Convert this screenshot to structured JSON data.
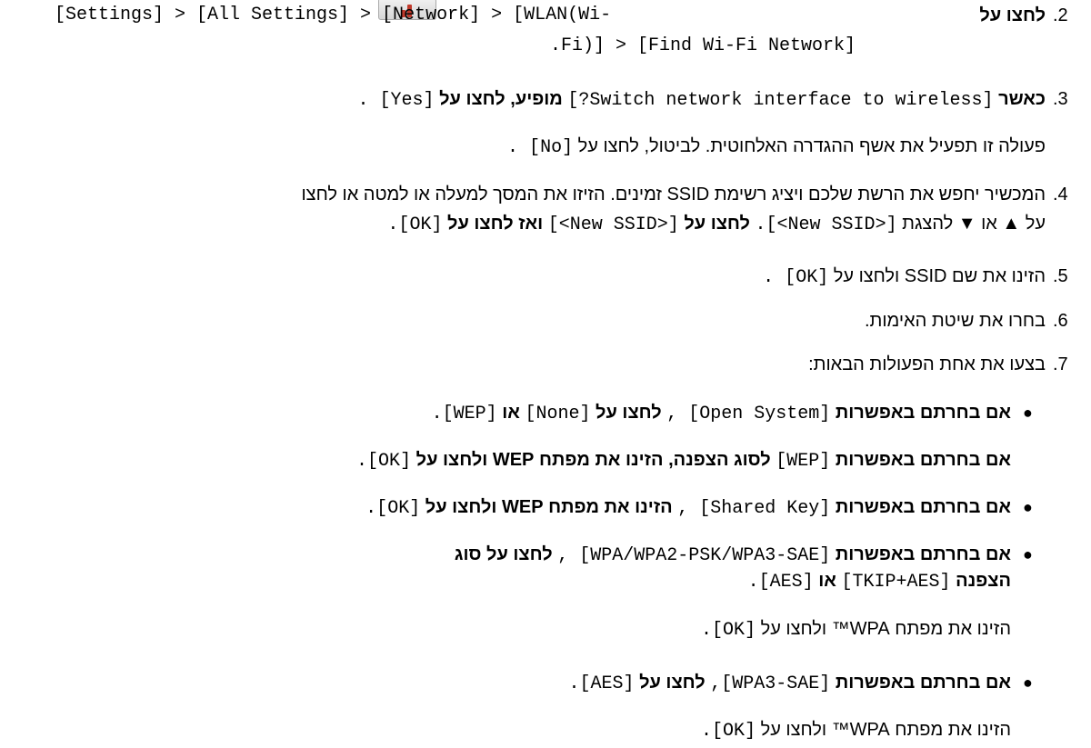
{
  "steps": {
    "s2": {
      "num": ".2",
      "verb": "לחצו על",
      "path1": "[Settings] > [All Settings] > [Network] > [WLAN(Wi-",
      "path2": ".Fi)] > [Find Wi-Fi Network]"
    },
    "s3": {
      "num": ".3",
      "when": "כאשר",
      "prompt": "[Switch network interface to wireless?]",
      "appears": "מופיע, לחצו על",
      "yes": "[Yes] .",
      "note": "פעולה זו תפעיל את אשף ההגדרה האלחוטית. לביטול, לחצו על",
      "no": "[No] ."
    },
    "s4": {
      "num": ".4",
      "line1": "המכשיר יחפש את הרשת שלכם ויציג רשימת SSID זמינים. הזיזו את המסך למעלה או למטה או לחצו",
      "l2a": "על ▲ או ▼ להצגת",
      "new_ssid1": "[<New SSID>].",
      "click": "לחצו על",
      "new_ssid2": "[<New SSID>]",
      "then_click": "ואז לחצו על",
      "ok": "[OK]."
    },
    "s5": {
      "num": ".5",
      "text": "הזינו את שם SSID ולחצו על",
      "ok": "[OK] ."
    },
    "s6": {
      "num": ".6",
      "text": "בחרו את שיטת האימות."
    },
    "s7": {
      "num": ".7",
      "text": "בצעו את אחת הפעולות הבאות:"
    }
  },
  "bullets": {
    "open": {
      "if": "אם בחרתם באפשרות",
      "opt": "[Open System] ,",
      "click": "לחצו על",
      "none": "[None]",
      "or": "או",
      "wep": "[WEP]."
    },
    "wep_note": {
      "if": "אם בחרתם באפשרות",
      "opt": "[WEP]",
      "text": "לסוג הצפנה, הזינו את מפתח WEP ולחצו על",
      "ok": "[OK]."
    },
    "shared": {
      "if": "אם בחרתם באפשרות",
      "opt": "[Shared Key] ,",
      "text": "הזינו את מפתח WEP ולחצו על",
      "ok": "[OK]."
    },
    "wpa": {
      "if": "אם בחרתם באפשרות",
      "opt": "[WPA/WPA2-PSK/WPA3-SAE] ,",
      "click": "לחצו על סוג",
      "enc": "הצפנה",
      "tkip": "[TKIP+AES]",
      "or": "או",
      "aes": "[AES].",
      "key_text": "הזינו את מפתח WPA™ ולחצו על",
      "ok": "[OK]."
    },
    "wpa3": {
      "if": "אם בחרתם באפשרות",
      "opt": "[WPA3-SAE],",
      "click": "לחצו על",
      "aes": "[AES].",
      "key_text": "הזינו את מפתח WPA™ ולחצו על",
      "ok": "[OK]."
    }
  }
}
